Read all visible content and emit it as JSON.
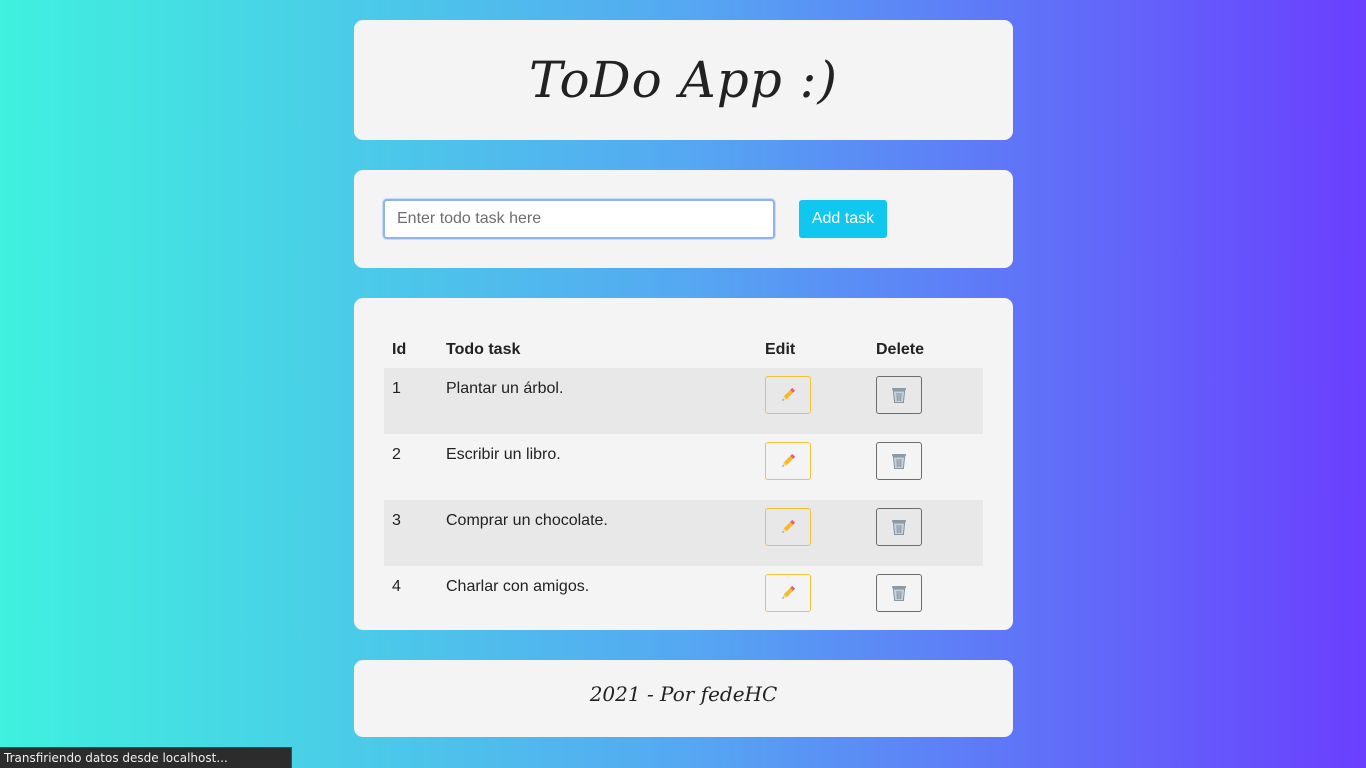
{
  "header": {
    "title": "ToDo App :)"
  },
  "form": {
    "input_placeholder": "Enter todo task here",
    "input_value": "",
    "add_button_label": "Add task",
    "add_button_color": "#10c7ef"
  },
  "table": {
    "columns": [
      "Id",
      "Todo task",
      "Edit",
      "Delete"
    ],
    "rows": [
      {
        "id": "1",
        "task": "Plantar un árbol.",
        "edit_icon": "pencil-icon",
        "delete_icon": "trash-icon"
      },
      {
        "id": "2",
        "task": "Escribir un libro.",
        "edit_icon": "pencil-icon",
        "delete_icon": "trash-icon"
      },
      {
        "id": "3",
        "task": "Comprar un chocolate.",
        "edit_icon": "pencil-icon",
        "delete_icon": "trash-icon"
      },
      {
        "id": "4",
        "task": "Charlar con amigos.",
        "edit_icon": "pencil-icon",
        "delete_icon": "trash-icon"
      }
    ]
  },
  "footer": {
    "text": "2021 - Por fedeHC"
  },
  "status_bar": {
    "text": "Transfiriendo datos desde localhost..."
  },
  "colors": {
    "background_gradient_start": "#3ff1de",
    "background_gradient_end": "#6a3ffe",
    "edit_border": "#f1c232",
    "delete_border": "#6c6c6c"
  }
}
